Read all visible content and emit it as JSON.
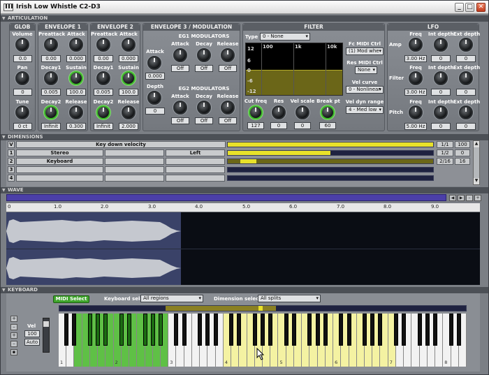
{
  "title": "Irish Low Whistle C2-D3",
  "sections": {
    "articulation": "ARTICULATION",
    "dimensions": "DIMENSIONS",
    "wave": "WAVE",
    "keyboard": "KEYBOARD"
  },
  "glob": {
    "title": "GLOB",
    "volume": "Volume",
    "volume_val": "0.0",
    "pan": "Pan",
    "pan_val": "0",
    "tune": "Tune",
    "tune_val": "0 ct"
  },
  "env1": {
    "title": "ENVELOPE 1",
    "preattack": "Preattack",
    "preattack_val": "0.00",
    "attack": "Attack",
    "attack_val": "0.000",
    "decay1": "Decay1",
    "decay1_val": "0.005",
    "sustain": "Sustain",
    "sustain_val": "100.0",
    "decay2": "Decay2",
    "decay2_val": "Infinit",
    "release": "Release",
    "release_val": "0.300"
  },
  "env2": {
    "title": "ENVELOPE 2",
    "preattack": "Preattack",
    "preattack_val": "0.00",
    "attack": "Attack",
    "attack_val": "0.000",
    "decay1": "Decay1",
    "decay1_val": "0.005",
    "sustain": "Sustain",
    "sustain_val": "100.0",
    "decay2": "Decay2",
    "decay2_val": "Infinit",
    "release": "Release",
    "release_val": "2.000"
  },
  "env3": {
    "title": "ENVELOPE 3 / MODULATION",
    "attack": "Attack",
    "attack_val": "0.000",
    "depth": "Depth",
    "depth_val": "0",
    "eg1": "EG1 MODULATORS",
    "eg2": "EG2 MODULATORS",
    "m_attack": "Attack",
    "m_decay": "Decay",
    "m_release": "Release",
    "off": "Off"
  },
  "filter": {
    "title": "FILTER",
    "type": "Type",
    "type_val": "0 - None",
    "grid_y": [
      "12",
      "6",
      "0",
      "-6",
      "-12"
    ],
    "grid_x": [
      "100",
      "1k",
      "10k"
    ],
    "fc_midi": "Fc MIDI Ctrl",
    "fc_midi_val": "(1) Mod whe",
    "res_midi": "Res MIDI Ctrl",
    "res_midi_val": "None",
    "vel_curve": "Vel curve",
    "vel_curve_val": "0 - Nonlinear",
    "vel_dyn": "Vel dyn range",
    "vel_dyn_val": "4 - Med low",
    "cutfreq": "Cut freq",
    "cutfreq_val": "127",
    "res": "Res",
    "res_val": "0",
    "velscale": "Vel scale",
    "velscale_val": "0",
    "breakpt": "Break pt",
    "breakpt_val": "60"
  },
  "lfo": {
    "title": "LFO",
    "freq": "Freq",
    "int_depth": "Int depth",
    "ext_depth": "Ext depth",
    "amp": "Amp",
    "filter": "Filter",
    "pitch": "Pitch",
    "amp_freq": "3.00 Hz",
    "filter_freq": "3.00 Hz",
    "pitch_freq": "5.00 Hz",
    "zero": "0"
  },
  "dims": {
    "rows": [
      {
        "idx": "V",
        "c1": "Key down velocity",
        "c2": "",
        "c3": "",
        "c4": "",
        "r1": "1/1",
        "r2": "100"
      },
      {
        "idx": "1",
        "c1": "Stereo",
        "c2": "",
        "c3": "Left",
        "c4": "",
        "r1": "1/2",
        "r2": "0"
      },
      {
        "idx": "2",
        "c1": "Keyboard",
        "c2": "",
        "c3": "",
        "c4": "",
        "r1": "2/16",
        "r2": "16"
      },
      {
        "idx": "3",
        "c1": "",
        "c2": "",
        "c3": "",
        "c4": "",
        "r1": "",
        "r2": ""
      },
      {
        "idx": "4",
        "c1": "",
        "c2": "",
        "c3": "",
        "c4": "",
        "r1": "",
        "r2": ""
      }
    ],
    "fills": [
      1.0,
      0.5,
      0.08,
      0,
      0
    ]
  },
  "wave": {
    "ticks": [
      "0",
      "1.0",
      "2.0",
      "3.0",
      "4.0",
      "5.0",
      "6.0",
      "7.0",
      "8.0",
      "9.0"
    ]
  },
  "keyboard": {
    "midi_select": "MIDI Select",
    "kb_select": "Keyboard select",
    "kb_select_val": "All regions",
    "dim_select": "Dimension select",
    "dim_select_val": "All splits",
    "vel": "Vel",
    "vel_val": "100",
    "auto": "Auto",
    "octaves": [
      "1",
      "2",
      "3",
      "4",
      "5",
      "6",
      "7",
      "8"
    ]
  },
  "colors": {
    "accent": "#e8e12a",
    "green": "#3fbb2a",
    "bg": "#7b7f85"
  }
}
